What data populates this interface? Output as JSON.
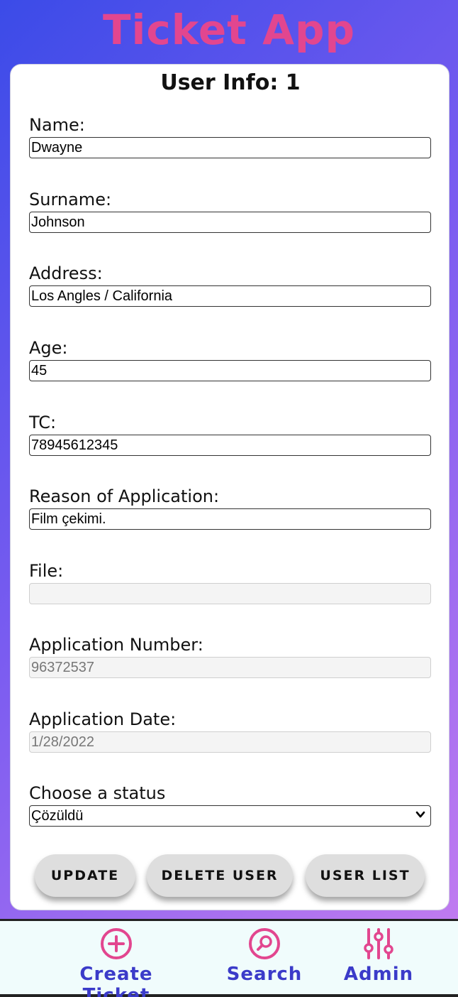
{
  "app": {
    "title": "Ticket App"
  },
  "card": {
    "title": "User Info: 1"
  },
  "form": {
    "name": {
      "label": "Name:",
      "value": "Dwayne"
    },
    "surname": {
      "label": "Surname:",
      "value": "Johnson"
    },
    "address": {
      "label": "Address:",
      "value": "Los Angles / California"
    },
    "age": {
      "label": "Age:",
      "value": "45"
    },
    "tc": {
      "label": "TC:",
      "value": "78945612345"
    },
    "reason": {
      "label": "Reason of Application:",
      "value": "Film çekimi."
    },
    "file": {
      "label": "File:",
      "value": ""
    },
    "app_number": {
      "label": "Application Number:",
      "value": "96372537"
    },
    "app_date": {
      "label": "Application Date:",
      "value": "1/28/2022"
    },
    "status": {
      "label": "Choose a status",
      "selected": "Çözüldü"
    }
  },
  "buttons": {
    "update": "UPDATE",
    "delete": "DELETE USER",
    "list": "USER LIST"
  },
  "nav": {
    "create": "Create Ticket",
    "search": "Search",
    "admin": "Admin"
  },
  "colors": {
    "title_pink": "#e2468f",
    "nav_blue": "#3b3bc9",
    "icon_pink": "#e2468f"
  },
  "icons": {
    "create": "plus-circle-icon",
    "search": "search-circle-icon",
    "admin": "sliders-icon"
  }
}
